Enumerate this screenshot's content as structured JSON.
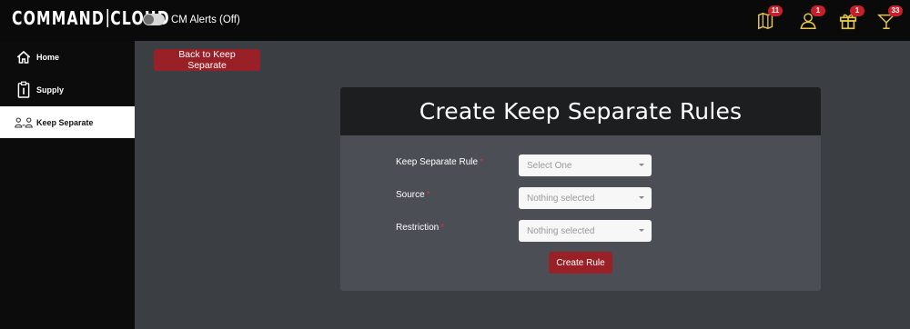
{
  "app": {
    "logo_left": "COMMAND",
    "logo_right": "CLOUD"
  },
  "alerts": {
    "label": "CM Alerts (Off)"
  },
  "top_icons": [
    {
      "name": "map-alerts-icon",
      "badge": "11"
    },
    {
      "name": "user-alerts-icon",
      "badge": "1"
    },
    {
      "name": "gift-icon",
      "badge": "1"
    },
    {
      "name": "cocktail-icon",
      "badge": "33"
    }
  ],
  "sidebar": {
    "items": [
      {
        "label": "Home",
        "icon": "home-icon"
      },
      {
        "label": "Supply",
        "icon": "supply-icon"
      },
      {
        "label": "Keep Separate",
        "icon": "keep-separate-icon",
        "active": true
      }
    ]
  },
  "main": {
    "back_button": "Back to Keep Separate",
    "card_title": "Create Keep Separate Rules",
    "fields": [
      {
        "label": "Keep Separate Rule",
        "required": "*",
        "placeholder": "Select One"
      },
      {
        "label": "Source",
        "required": "*",
        "placeholder": "Nothing selected"
      },
      {
        "label": "Restriction",
        "required": "*",
        "placeholder": "Nothing selected"
      }
    ],
    "submit_button": "Create Rule"
  },
  "colors": {
    "accent": "#9a2027",
    "badge": "#c8202a",
    "background": "#3b3e43",
    "sidebar": "#0c0c0c"
  }
}
